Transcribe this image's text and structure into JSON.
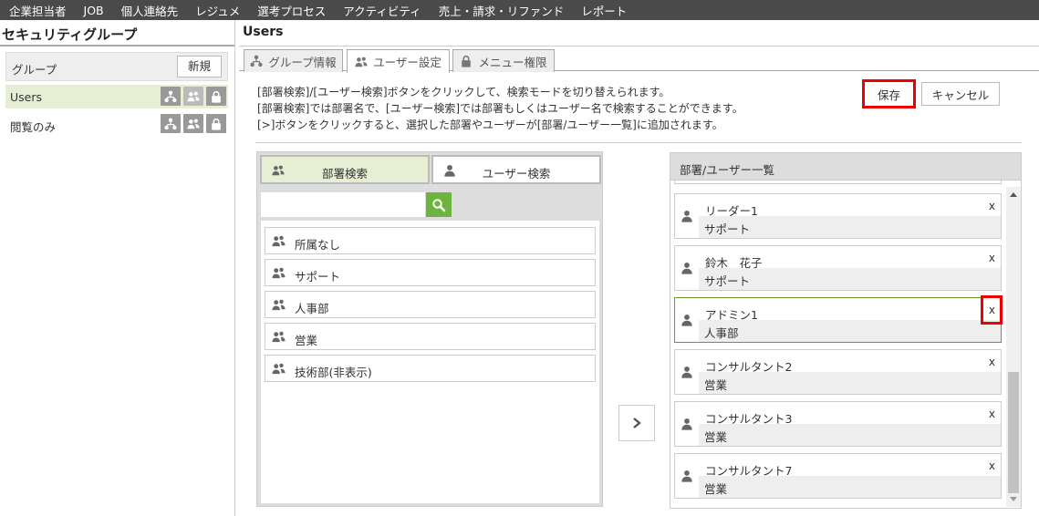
{
  "nav": [
    "企業担当者",
    "JOB",
    "個人連絡先",
    "レジュメ",
    "選考プロセス",
    "アクティビティ",
    "売上・請求・リファンド",
    "レポート"
  ],
  "left": {
    "title": "セキュリティグループ",
    "group_label": "グループ",
    "new_button": "新規",
    "groups": [
      "Users",
      "閲覧のみ"
    ]
  },
  "main": {
    "title": "Users",
    "tabs": [
      "グループ情報",
      "ユーザー設定",
      "メニュー権限"
    ],
    "info": [
      "[部署検索]/[ユーザー検索]ボタンをクリックして、検索モードを切り替えられます。",
      "[部署検索]では部署名で、[ユーザー検索]では部署もしくはユーザー名で検索することができます。",
      "[>]ボタンをクリックすると、選択した部署やユーザーが[部署/ユーザー一覧]に追加されます。"
    ],
    "save": "保存",
    "cancel": "キャンセル"
  },
  "search": {
    "tabs": [
      "部署検索",
      "ユーザー検索"
    ],
    "input_value": "",
    "departments": [
      "所属なし",
      "サポート",
      "人事部",
      "営業",
      "技術部(非表示)"
    ]
  },
  "add_button": "›",
  "right": {
    "title": "部署/ユーザー一覧",
    "items": [
      {
        "name": "リーダー1",
        "dept": "サポート",
        "x": "x"
      },
      {
        "name": "鈴木　花子",
        "dept": "サポート",
        "x": "x"
      },
      {
        "name": "アドミン1",
        "dept": "人事部",
        "x": "x"
      },
      {
        "name": "コンサルタント2",
        "dept": "営業",
        "x": "x"
      },
      {
        "name": "コンサルタント3",
        "dept": "営業",
        "x": "x"
      },
      {
        "name": "コンサルタント7",
        "dept": "営業",
        "x": "x"
      }
    ]
  },
  "colors": {
    "nav_bg": "#4a4a4a",
    "selected_row": "#e6eed4",
    "search_button": "#6db33f",
    "highlight_red": "#ee0000"
  }
}
